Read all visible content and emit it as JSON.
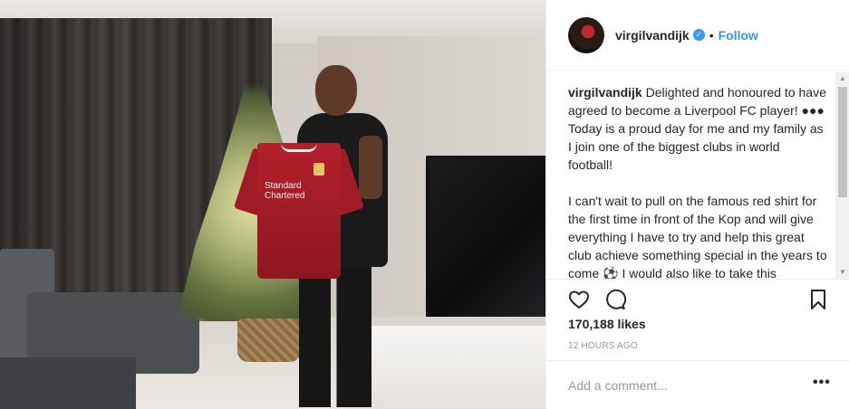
{
  "post": {
    "username": "virgilvandijk",
    "verified_icon": "verified-badge-icon",
    "separator": "•",
    "follow_label": "Follow",
    "caption_username": "virgilvandijk",
    "caption_p1": " Delighted and honoured to have agreed to become a Liverpool FC player! ●●● Today is a proud day for me and my family as I join one of the biggest clubs in world football!",
    "caption_p2": "I can't wait to pull on the famous red shirt for the first time in front of the Kop and will give everything I have to try and help this great club achieve something special in the years to come ⚽ I would also like to take this opportunity to say thank you to Les",
    "likes": "170,188 likes",
    "timestamp": "12 HOURS AGO",
    "comment_placeholder": "Add a comment...",
    "more_label": "•••"
  },
  "photo": {
    "shirt_sponsor": "Standard Chartered"
  },
  "icons": {
    "like": "heart-icon",
    "comment": "comment-bubble-icon",
    "save": "bookmark-icon",
    "more": "more-options-icon"
  },
  "colors": {
    "accent": "#3897f0",
    "text": "#262626",
    "muted": "#999999",
    "divider": "#efefef"
  }
}
